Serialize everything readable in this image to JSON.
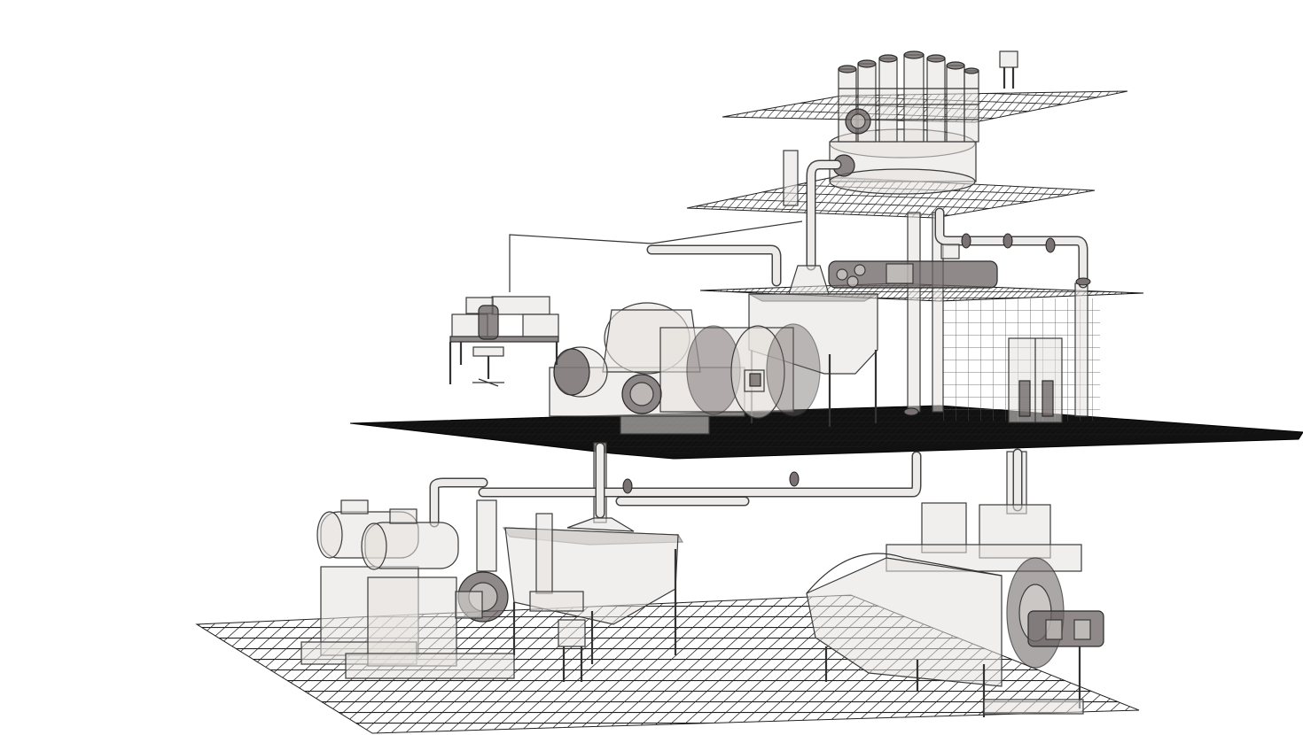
{
  "scene": {
    "type": "isometric industrial grinding plant diagram",
    "levels": [
      {
        "name": "top-cyclone-deck"
      },
      {
        "name": "upper-service-deck"
      },
      {
        "name": "mill-floor"
      },
      {
        "name": "ground-floor"
      }
    ],
    "equipment": [
      "hydrocyclone-cluster",
      "distribution-tank",
      "ball-mill",
      "sump-hopper",
      "mill-hopper",
      "control-desk",
      "operator-chair",
      "pump-motor",
      "slurry-pump",
      "drum-filter",
      "electrical-cabinet"
    ],
    "colors": {
      "structure": "#2a2a2a",
      "equipment_fill": "#e6e1df",
      "equipment_dark": "#6a6262",
      "background": "#ffffff"
    }
  }
}
